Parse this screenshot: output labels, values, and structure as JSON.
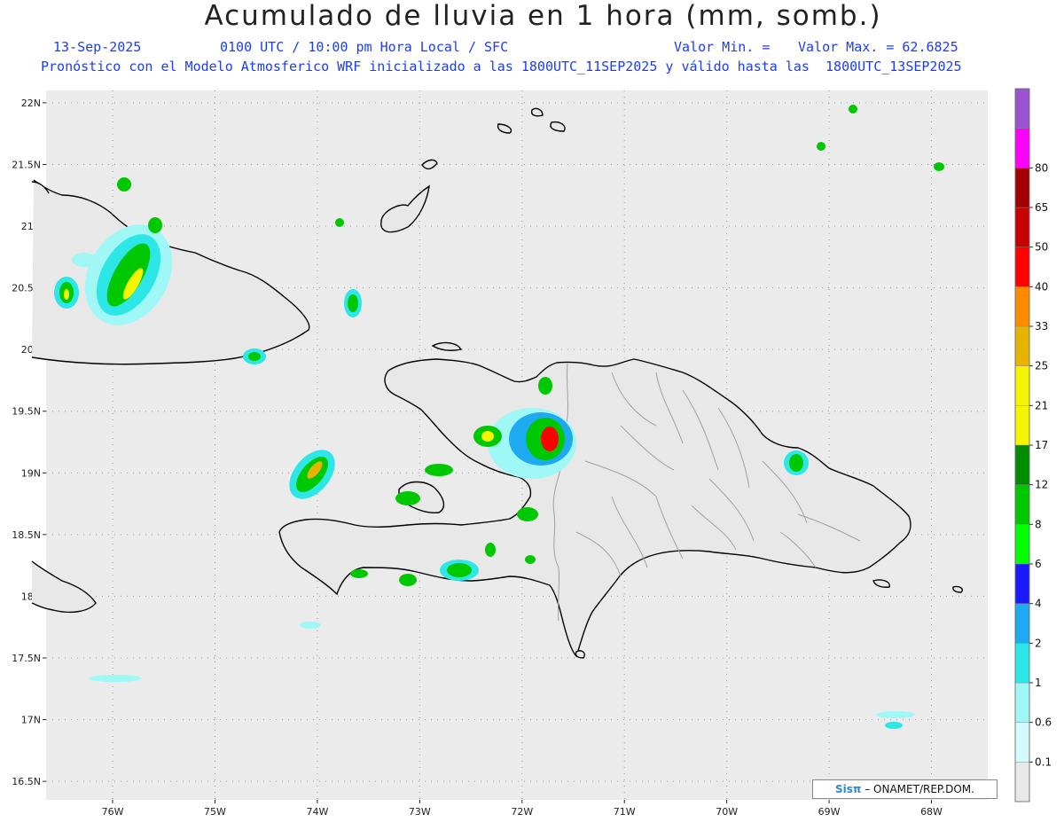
{
  "header": {
    "title": "Acumulado de lluvia en 1 hora (mm, somb.)",
    "date": "13-Sep-2025",
    "time": "0100 UTC / 10:00 pm Hora Local / SFC",
    "min_label": "Valor Min. =",
    "max_label": "Valor Max. = 62.6825",
    "forecast_note": "Pronóstico con el Modelo Atmosferico WRF inicializado a las 1800UTC_11SEP2025 y válido hasta las  1800UTC_13SEP2025"
  },
  "map": {
    "lon_range": [
      -76.65,
      -67.45
    ],
    "lat_range": [
      16.35,
      22.1
    ],
    "lon_ticks": [
      "76W",
      "75W",
      "74W",
      "73W",
      "72W",
      "71W",
      "70W",
      "69W",
      "68W"
    ],
    "lat_ticks": [
      "22N",
      "21.5N",
      "21N",
      "20.5N",
      "20N",
      "19.5N",
      "19N",
      "18.5N",
      "18N",
      "17.5N",
      "17N",
      "16.5N"
    ],
    "background_color": "#ebebeb",
    "coast_color": "#000000",
    "border_color": "#a0a0a0"
  },
  "colorbar": {
    "labels": [
      "0.1",
      "0.6",
      "1",
      "2",
      "4",
      "6",
      "8",
      "12",
      "17",
      "21",
      "25",
      "33",
      "40",
      "50",
      "65",
      "80"
    ],
    "colors": [
      "#e8e8e8",
      "#d2fafa",
      "#9ff8f6",
      "#2de6e6",
      "#1eaaf0",
      "#1a1aff",
      "#00ff00",
      "#00c800",
      "#008c00",
      "#f5f500",
      "#f5f500",
      "#e6b400",
      "#ff8c00",
      "#ff0000",
      "#c80000",
      "#a00000",
      "#ff00ff",
      "#9a54d0"
    ]
  },
  "credit": {
    "logo": "Sisπ",
    "text": " – ONAMET/REP.DOM."
  }
}
